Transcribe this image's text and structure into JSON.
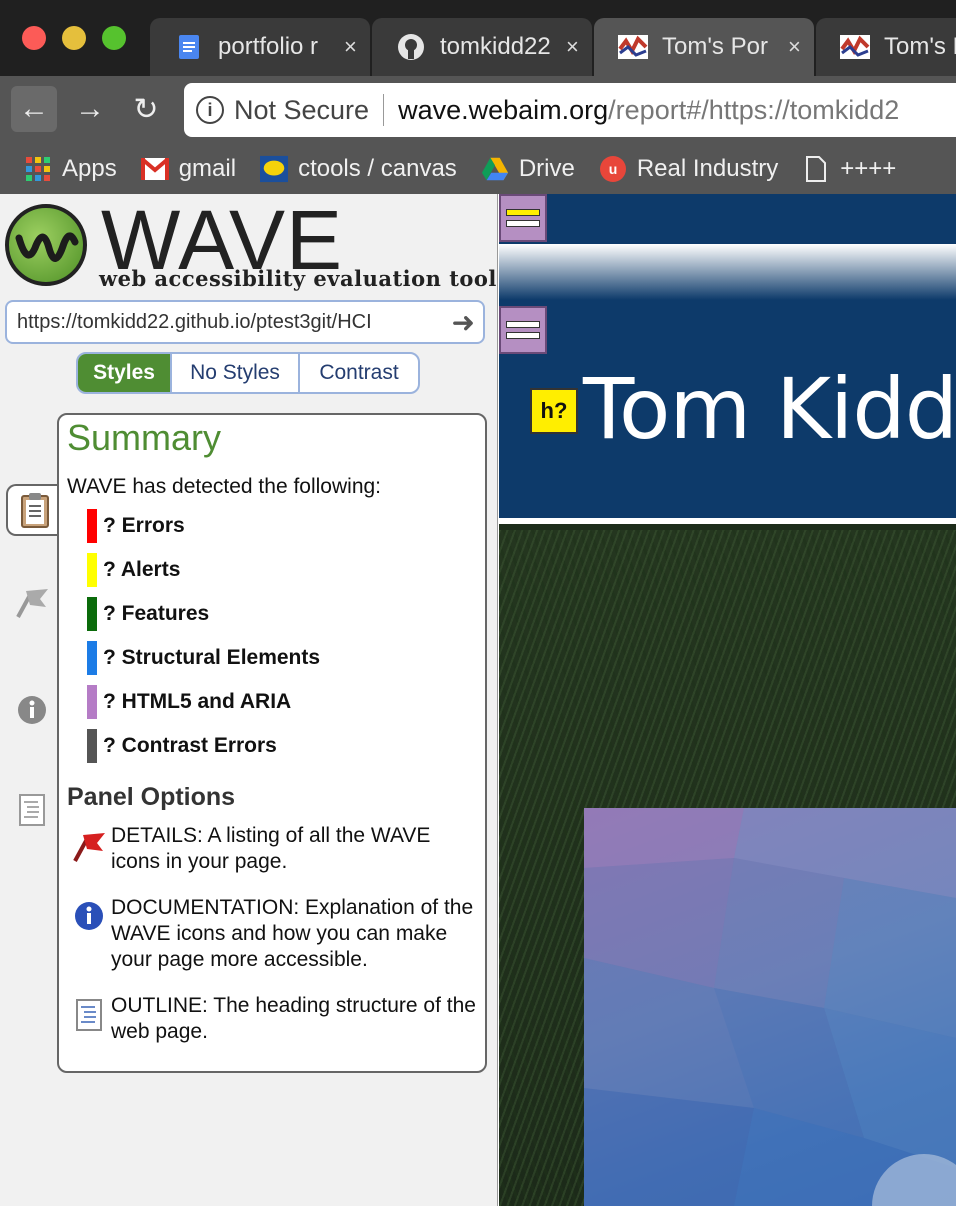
{
  "browser": {
    "tabs": [
      {
        "title": "portfolio r",
        "icon": "google-docs-icon"
      },
      {
        "title": "tomkidd22",
        "icon": "github-icon"
      },
      {
        "title": "Tom's Por",
        "icon": "site-icon"
      },
      {
        "title": "Tom's P",
        "icon": "site-icon"
      }
    ],
    "tab_close": "×",
    "address": {
      "security_label": "Not Secure",
      "host": "wave.webaim.org",
      "path": "/report#/https://tomkidd2"
    },
    "bookmarks": [
      {
        "label": "Apps",
        "icon": "apps-grid-icon"
      },
      {
        "label": "gmail",
        "icon": "gmail-icon"
      },
      {
        "label": "ctools / canvas",
        "icon": "ctools-icon"
      },
      {
        "label": "Drive",
        "icon": "google-drive-icon"
      },
      {
        "label": "Real Industry",
        "icon": "real-industry-icon"
      },
      {
        "label": "++++",
        "icon": "page-icon"
      }
    ]
  },
  "wave": {
    "logo_word": "WAVE",
    "logo_subtitle": "web accessibility evaluation tool",
    "url_value": "https://tomkidd22.github.io/ptest3git/HCI",
    "view_tabs": [
      "Styles",
      "No Styles",
      "Contrast"
    ],
    "summary": {
      "title": "Summary",
      "detected_text": "WAVE has detected the following:",
      "counts": [
        {
          "label": "? Errors",
          "color": "#ff0000"
        },
        {
          "label": "? Alerts",
          "color": "#ffff00"
        },
        {
          "label": "? Features",
          "color": "#0b6b0b"
        },
        {
          "label": "? Structural Elements",
          "color": "#1c7ce6"
        },
        {
          "label": "? HTML5 and ARIA",
          "color": "#b57cc6"
        },
        {
          "label": "? Contrast Errors",
          "color": "#555555"
        }
      ],
      "panel_options_title": "Panel Options",
      "options": [
        {
          "text": "DETAILS: A listing of all the WAVE icons in your page.",
          "icon": "flag-icon"
        },
        {
          "text": "DOCUMENTATION: Explanation of the WAVE icons and how you can make your page more accessible.",
          "icon": "info-icon"
        },
        {
          "text": "OUTLINE: The heading structure of the web page.",
          "icon": "outline-icon"
        }
      ]
    }
  },
  "page": {
    "h_flag": "h?",
    "site_title": "Tom Kidd"
  }
}
